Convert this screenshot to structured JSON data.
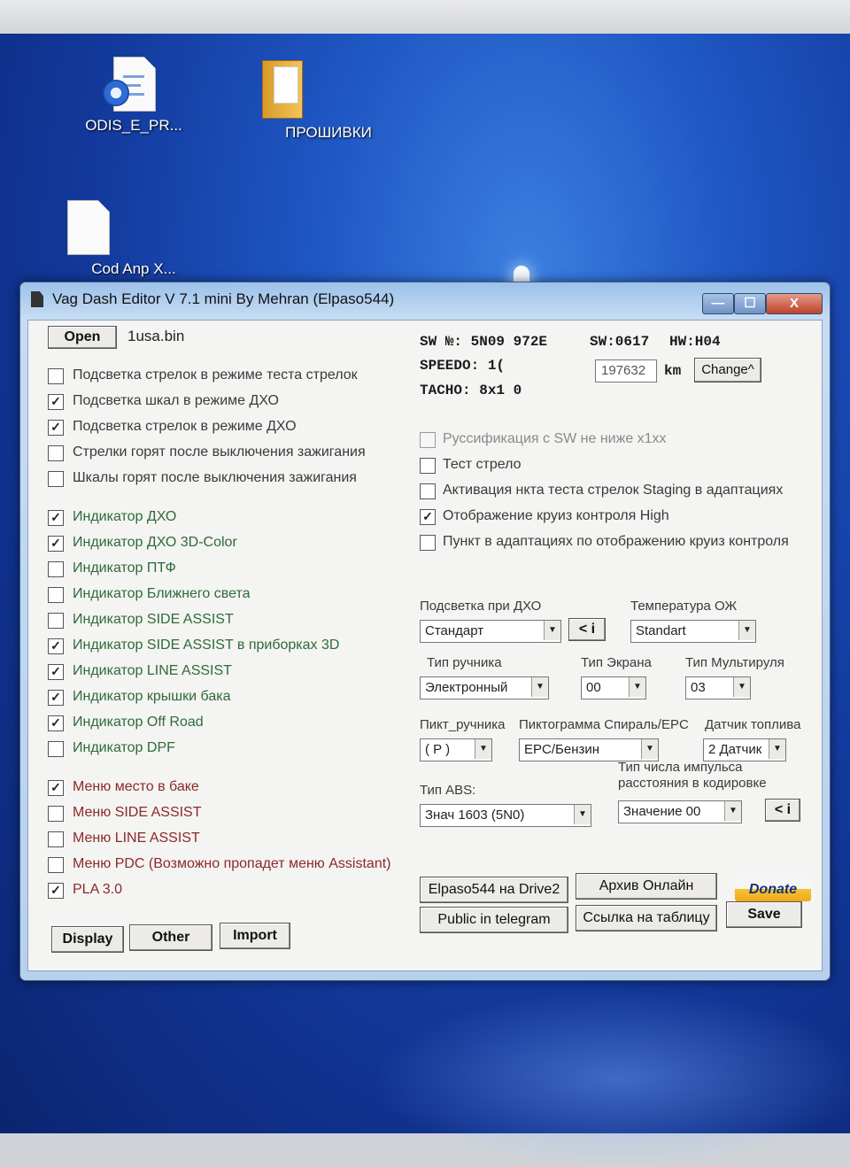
{
  "desktop": {
    "icons": [
      {
        "label": "ODIS_E_PR...",
        "icon": "document-gear-icon"
      },
      {
        "label": "ПРОШИВКИ",
        "icon": "folder-icon"
      },
      {
        "label": "Cod Anp X...",
        "icon": "document-icon"
      }
    ]
  },
  "window": {
    "title": "Vag Dash Editor V 7.1 mini By Mehran (Elpaso544)",
    "controls": {
      "minimize": "—",
      "maximize": "☐",
      "close": "X"
    },
    "open_label": "Open",
    "file_name": "1usa.bin",
    "info": {
      "sw_nr": "SW №:  5N09  972E",
      "sw": "SW:0617",
      "hw": "HW:H04",
      "speedo": "SPEEDO:  1(",
      "tacho": "TACHO:  8x1  0",
      "km_value": "197632",
      "km_unit": "km",
      "change_label": "Change^"
    },
    "left_options": [
      {
        "label": "Подсветка стрелок в режиме теста стрелок",
        "checked": false
      },
      {
        "label": "Подсветка шкал в режиме ДХО",
        "checked": true
      },
      {
        "label": "Подсветка стрелок в режиме ДХО",
        "checked": true
      },
      {
        "label": "Стрелки горят после выключения зажигания",
        "checked": false
      },
      {
        "label": "Шкалы горят после выключения зажигания",
        "checked": false
      },
      {
        "label": "Индикатор ДХО",
        "checked": true
      },
      {
        "label": "Индикатор ДХО 3D-Color",
        "checked": true
      },
      {
        "label": "Индикатор ПТФ",
        "checked": false
      },
      {
        "label": "Индикатор Ближнего света",
        "checked": false
      },
      {
        "label": "Индикатор SIDE ASSIST",
        "checked": false
      },
      {
        "label": "Индикатор SIDE ASSIST в приборках 3D",
        "checked": true
      },
      {
        "label": "Индикатор LINE ASSIST",
        "checked": true
      },
      {
        "label": "Индикатор крышки бака",
        "checked": true
      },
      {
        "label": "Индикатор Off Road",
        "checked": true
      },
      {
        "label": "Индикатор DPF",
        "checked": false
      },
      {
        "label": "Меню место в баке",
        "checked": true
      },
      {
        "label": "Меню SIDE ASSIST",
        "checked": false
      },
      {
        "label": "Меню LINE ASSIST",
        "checked": false
      },
      {
        "label": "Меню PDC (Возможно пропадет меню Assistant)",
        "checked": false
      },
      {
        "label": "PLA 3.0",
        "checked": true
      }
    ],
    "right_options": [
      {
        "label": "Руссификация с SW не ниже x1xx",
        "checked": false,
        "disabled": true
      },
      {
        "label": "Тест стрело",
        "checked": false,
        "disabled": false
      },
      {
        "label": "Активация  нкта теста стрелок Staging в адаптациях",
        "checked": false,
        "disabled": false
      },
      {
        "label": "Отображение круиз контроля High",
        "checked": true,
        "disabled": false
      },
      {
        "label": "Пункт в адаптациях по отображению круиз контроля",
        "checked": false,
        "disabled": false
      }
    ],
    "selects": {
      "drl_light": {
        "label": "Подсветка при ДХО",
        "value": "Стандарт",
        "info_button": "< i"
      },
      "coolant_temp": {
        "label": "Температура ОЖ",
        "value": "Standart"
      },
      "handbrake_type": {
        "label": "Тип ручника",
        "value": "Электронный"
      },
      "screen_type": {
        "label": "Тип Экрана",
        "value": "00"
      },
      "multiwheel_type": {
        "label": "Тип Мультируля",
        "value": "03"
      },
      "handbrake_icon": {
        "label": "Пикт_ручника",
        "value": "( P )"
      },
      "spiral_epc_icon": {
        "label": "Пиктограмма Спираль/EPC",
        "value": "EPC/Бензин"
      },
      "fuel_sensor": {
        "label": "Датчик топлива",
        "value": "2 Датчик"
      },
      "abs_type": {
        "label": "Тип ABS:",
        "value": "Знач 1603 (5N0)"
      },
      "pulse_type": {
        "label": "Тип числа импульса расстояния в кодировке",
        "value": "Значение 00",
        "info_button": "< i"
      }
    },
    "buttons": {
      "drive2": "Elpaso544 на Drive2",
      "archive": "Архив Онлайн",
      "donate": "Donate",
      "telegram": "Public in telegram",
      "table_link": "Ссылка на таблицу",
      "save": "Save",
      "display": "Display",
      "other": "Other",
      "import": "Import"
    }
  }
}
